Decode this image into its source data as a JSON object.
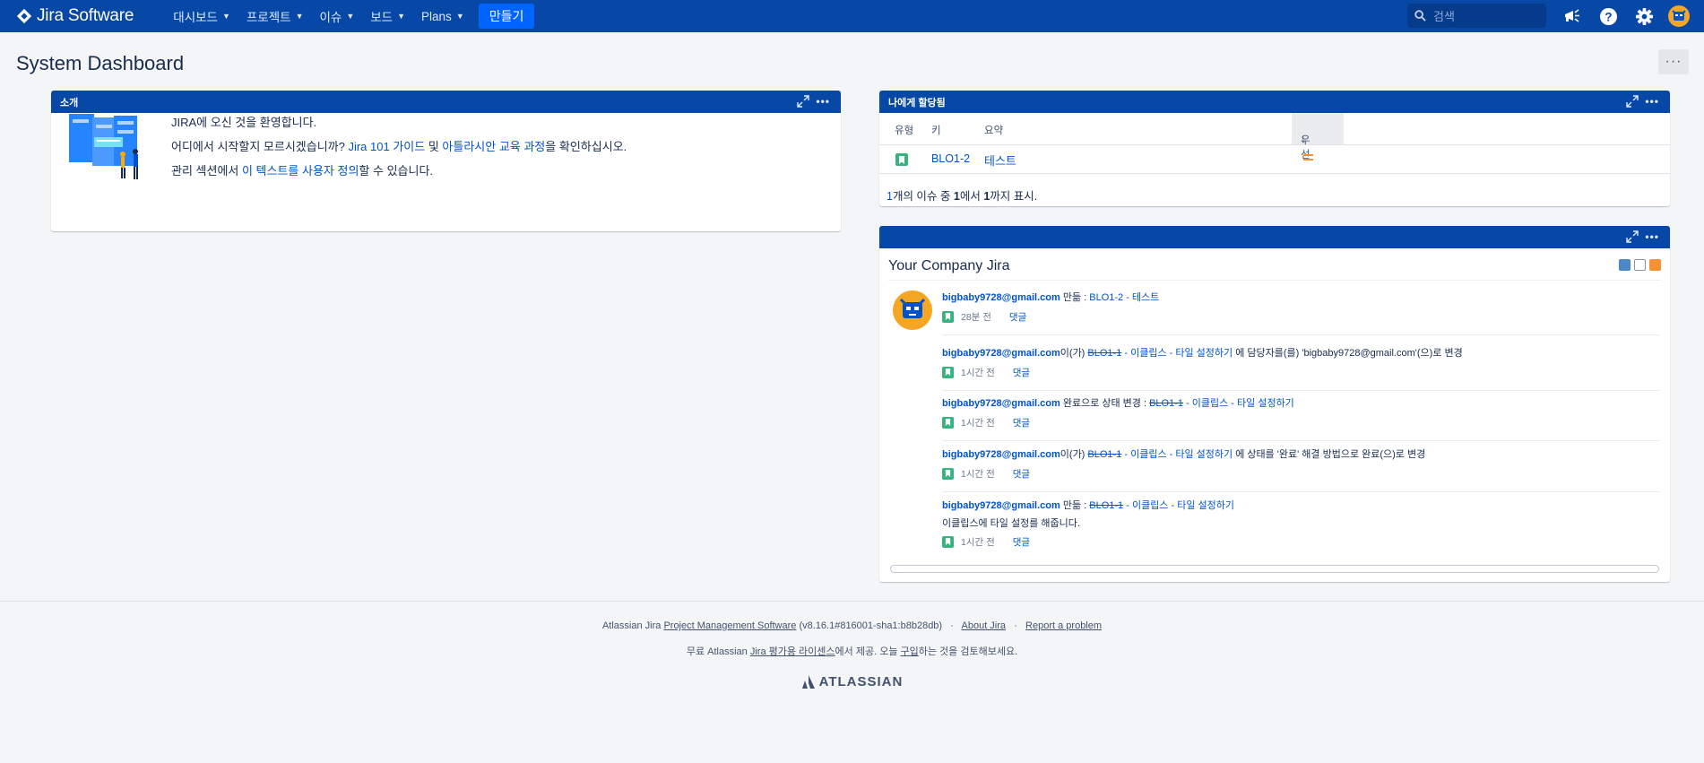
{
  "app": {
    "logo_text": "Jira Software"
  },
  "nav": {
    "items": [
      {
        "label": "대시보드"
      },
      {
        "label": "프로젝트"
      },
      {
        "label": "이슈"
      },
      {
        "label": "보드"
      },
      {
        "label": "Plans"
      }
    ],
    "create_label": "만들기",
    "search_placeholder": "검색"
  },
  "page": {
    "title": "System Dashboard",
    "menu_label": "···"
  },
  "intro_gadget": {
    "title": "소개",
    "line1": "JIRA에 오신 것을 환영합니다.",
    "line2_pre": "어디에서 시작할지 모르시겠습니까? ",
    "line2_link1": "Jira 101 가이드",
    "line2_mid": " 및 ",
    "line2_link2": "아틀라시안 교육 과정",
    "line2_post": "을 확인하십시오.",
    "line3_pre": "관리 섹션에서 ",
    "line3_link": "이 텍스트를 사용자 정의",
    "line3_post": "할 수 있습니다."
  },
  "assigned_gadget": {
    "title": "나에게 할당됨",
    "columns": {
      "type": "유형",
      "key": "키",
      "summary": "요약",
      "priority": "우선"
    },
    "rows": [
      {
        "key": "BLO1-2",
        "summary": "테스트"
      }
    ],
    "footer": {
      "count_link": "1",
      "text1": "개의 이슈 중 ",
      "from": "1",
      "text2": "에서 ",
      "to": "1",
      "text3": "까지 표시."
    }
  },
  "stream_gadget": {
    "title": "Your Company Jira",
    "activities": [
      {
        "user": "bigbaby9728@gmail.com",
        "pre": " 만듦 : ",
        "issue": "",
        "issue_title": "BLO1-2 - 테스트",
        "post": "",
        "time": "28분 전",
        "comment": "댓글"
      },
      {
        "user": "bigbaby9728@gmail.com",
        "pre": "이(가) ",
        "issue": "BLO1-1",
        "issue_title": " - 이클립스 - 타일 설정하기",
        "post": " 에 담당자를(를) 'bigbaby9728@gmail.com'(으)로 변경",
        "time": "1시간 전",
        "comment": "댓글"
      },
      {
        "user": "bigbaby9728@gmail.com",
        "pre": " 완료으로 상태 변경 : ",
        "issue": "BLO1-1",
        "issue_title": " - 이클립스 - 타일 설정하기",
        "post": "",
        "time": "1시간 전",
        "comment": "댓글"
      },
      {
        "user": "bigbaby9728@gmail.com",
        "pre": "이(가) ",
        "issue": "BLO1-1",
        "issue_title": " - 이클립스 - 타일 설정하기",
        "post": " 에 상태를 '완료' 해결 방법으로 완료(으)로 변경",
        "time": "1시간 전",
        "comment": "댓글"
      },
      {
        "user": "bigbaby9728@gmail.com",
        "pre": " 만듦 : ",
        "issue": "BLO1-1",
        "issue_title": " - 이클립스 - 타일 설정하기",
        "post": "",
        "desc": "이클립스에 타일 설정를 해줍니다.",
        "time": "1시간 전",
        "comment": "댓글"
      }
    ]
  },
  "footer": {
    "l1_a": "Atlassian Jira ",
    "l1_link": "Project Management Software",
    "l1_b": " (v8.16.1#816001-sha1:b8b28db)",
    "l1_sep": "·",
    "about": "About Jira",
    "report": "Report a problem",
    "l2_a": "무료 Atlassian ",
    "l2_link1": "Jira 평가용 라이센스",
    "l2_b": "에서 제공. 오늘 ",
    "l2_link2": "구입",
    "l2_c": "하는 것을 검토해보세요.",
    "brand": "ATLASSIAN"
  },
  "colors": {
    "nav_bg": "#0747a6",
    "accent": "#0065ff",
    "story": "#36b37e",
    "priority_medium": "#f79232"
  }
}
